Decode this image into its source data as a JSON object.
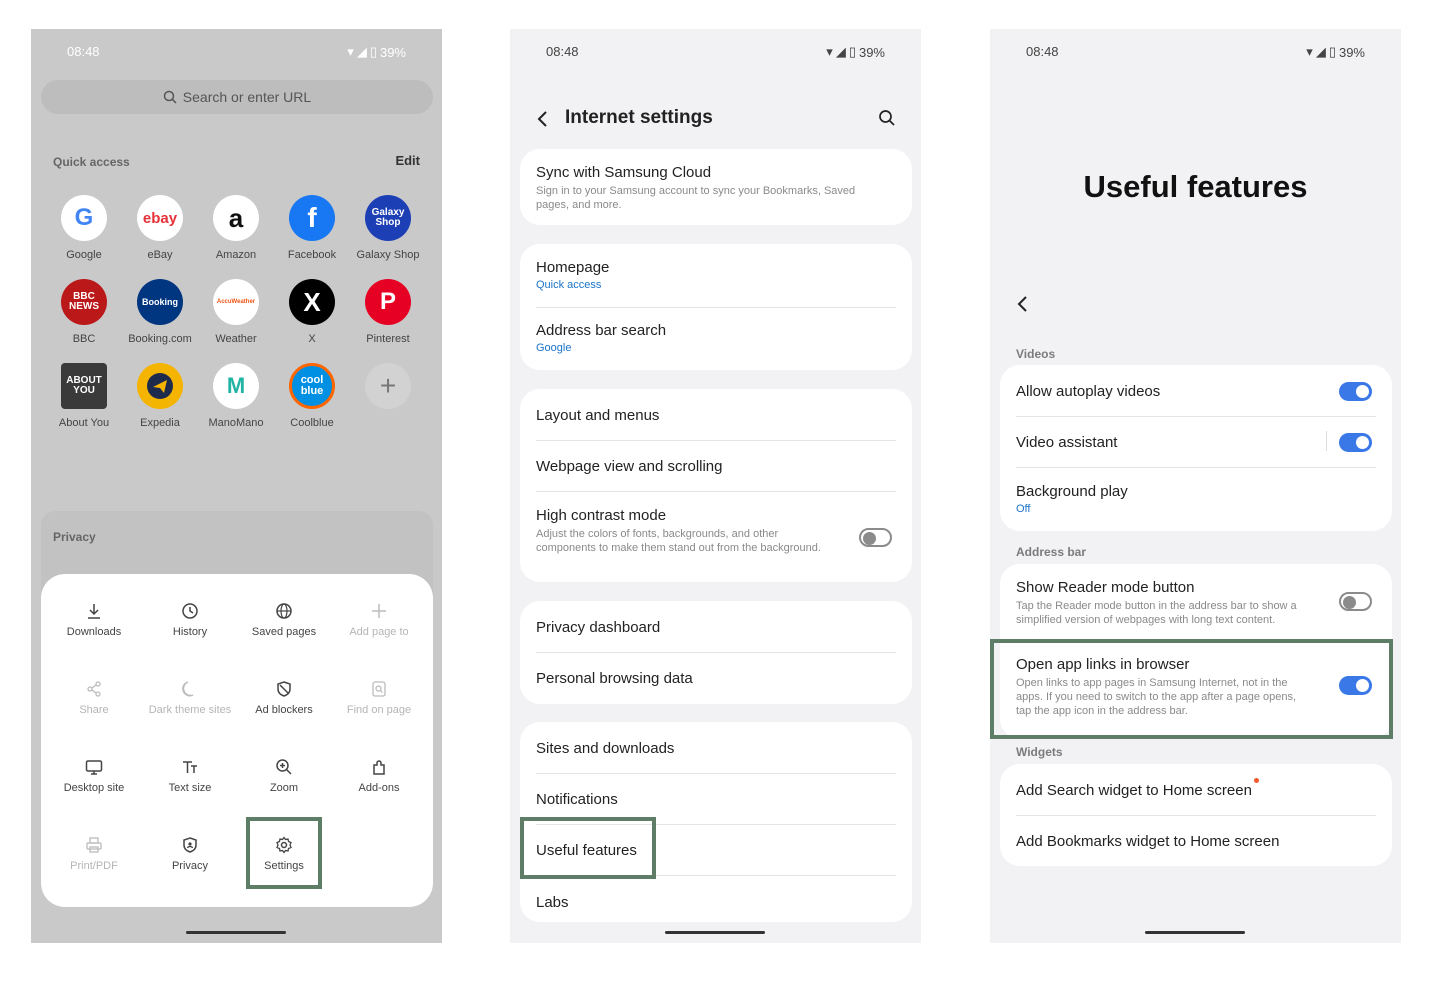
{
  "status": {
    "time": "08:48",
    "battery": "39%"
  },
  "browser": {
    "search_placeholder": "Search or enter URL",
    "quick_access_title": "Quick access",
    "edit_label": "Edit",
    "apps": [
      {
        "label": "Google",
        "icon": "G"
      },
      {
        "label": "eBay",
        "icon": "ebay"
      },
      {
        "label": "Amazon",
        "icon": "a"
      },
      {
        "label": "Facebook",
        "icon": "f"
      },
      {
        "label": "Galaxy Shop",
        "icon": "Galaxy Shop"
      },
      {
        "label": "BBC",
        "icon": "BBC NEWS"
      },
      {
        "label": "Booking.com",
        "icon": "Booking"
      },
      {
        "label": "Weather",
        "icon": "AccuWeather"
      },
      {
        "label": "X",
        "icon": "X"
      },
      {
        "label": "Pinterest",
        "icon": "P"
      },
      {
        "label": "About You",
        "icon": "ABOUT YOU"
      },
      {
        "label": "Expedia",
        "icon": "expedia"
      },
      {
        "label": "ManoMano",
        "icon": "M"
      },
      {
        "label": "Coolblue",
        "icon": "cool blue"
      },
      {
        "label": "",
        "icon": "+"
      }
    ],
    "privacy_title": "Privacy",
    "menu": [
      {
        "label": "Downloads",
        "icon": "download-icon"
      },
      {
        "label": "History",
        "icon": "history-icon"
      },
      {
        "label": "Saved pages",
        "icon": "globe-icon"
      },
      {
        "label": "Add page to",
        "icon": "plus-icon"
      },
      {
        "label": "Share",
        "icon": "share-icon"
      },
      {
        "label": "Dark theme sites",
        "icon": "moon-icon"
      },
      {
        "label": "Ad blockers",
        "icon": "block-icon"
      },
      {
        "label": "Find on page",
        "icon": "find-icon"
      },
      {
        "label": "Desktop site",
        "icon": "desktop-icon"
      },
      {
        "label": "Text size",
        "icon": "text-size-icon"
      },
      {
        "label": "Zoom",
        "icon": "zoom-icon"
      },
      {
        "label": "Add-ons",
        "icon": "puzzle-icon"
      },
      {
        "label": "Print/PDF",
        "icon": "print-icon"
      },
      {
        "label": "Privacy",
        "icon": "shield-icon"
      },
      {
        "label": "Settings",
        "icon": "gear-icon"
      }
    ]
  },
  "settings": {
    "title": "Internet settings",
    "sync_title": "Sync with Samsung Cloud",
    "sync_desc": "Sign in to your Samsung account to sync your Bookmarks, Saved pages, and more.",
    "homepage_title": "Homepage",
    "homepage_value": "Quick access",
    "address_title": "Address bar search",
    "address_value": "Google",
    "layout": "Layout and menus",
    "webpage": "Webpage view and scrolling",
    "contrast_title": "High contrast mode",
    "contrast_desc": "Adjust the colors of fonts, backgrounds, and other components to make them stand out from the background.",
    "privacy_dashboard": "Privacy dashboard",
    "personal_data": "Personal browsing data",
    "sites": "Sites and downloads",
    "notifications": "Notifications",
    "useful": "Useful features",
    "labs": "Labs"
  },
  "useful": {
    "title": "Useful features",
    "videos_section": "Videos",
    "autoplay": "Allow autoplay videos",
    "assistant": "Video assistant",
    "bg_play": "Background play",
    "bg_play_value": "Off",
    "address_section": "Address bar",
    "reader_title": "Show Reader mode button",
    "reader_desc": "Tap the Reader mode button in the address bar to show a simplified version of webpages with long text content.",
    "applinks_title": "Open app links in browser",
    "applinks_desc": "Open links to app pages in Samsung Internet, not in the apps. If you need to switch to the app after a page opens, tap the app icon in the address bar.",
    "widgets_section": "Widgets",
    "search_widget": "Add Search widget to Home screen",
    "bookmarks_widget": "Add Bookmarks widget to Home screen"
  }
}
